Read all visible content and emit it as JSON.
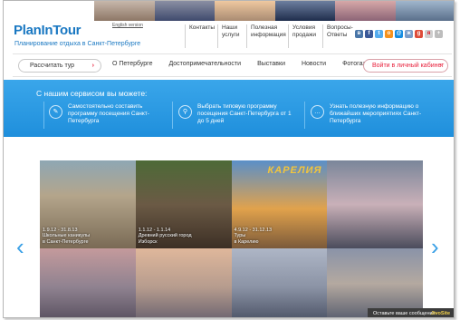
{
  "header": {
    "logo": "PlanInTour",
    "english_link": "English version",
    "tagline": "Планирование отдыха в Санкт-Петербурге",
    "top_nav": [
      "Контакты",
      "Наши услуги",
      "Полезная информация",
      "Условия продажи",
      "Вопросы-Ответы"
    ]
  },
  "socials": [
    {
      "icon": "vk-icon",
      "color": "#4a76a8",
      "glyph": "в"
    },
    {
      "icon": "facebook-icon",
      "color": "#3b5998",
      "glyph": "f"
    },
    {
      "icon": "twitter-icon",
      "color": "#55acee",
      "glyph": "t"
    },
    {
      "icon": "odnoklassniki-icon",
      "color": "#f7931e",
      "glyph": "о"
    },
    {
      "icon": "mailru-icon",
      "color": "#168de2",
      "glyph": "@"
    },
    {
      "icon": "livejournal-icon",
      "color": "#7a9cc9",
      "glyph": "ж"
    },
    {
      "icon": "google-icon",
      "color": "#dd4b39",
      "glyph": "g"
    },
    {
      "icon": "yandex-icon",
      "color": "#cfcfcf",
      "glyph": "я"
    },
    {
      "icon": "plus-icon",
      "color": "#bdbdbd",
      "glyph": "+"
    }
  ],
  "navbar": {
    "calc_button": "Рассчитать тур",
    "links": [
      "О Петербурге",
      "Достопримечательности",
      "Выставки",
      "Новости",
      "Фотогалерея"
    ],
    "login_button": "Войти в личный кабинет",
    "arrow": "›"
  },
  "service": {
    "title": "С нашим сервисом вы можете:",
    "features": [
      {
        "text": "Самостоятельно составить программу посещения Санкт-Петербурга",
        "glyph": "✎"
      },
      {
        "text": "Выбрать типовую программу посещения Санкт-Петербурга от 1 до 5 дней",
        "glyph": "⚲"
      },
      {
        "text": "Узнать полезную информацию о ближайших мероприятиях Санкт-Петербурга",
        "glyph": "…"
      }
    ]
  },
  "gallery": {
    "tiles": [
      {
        "dates": "1.9.12 - 31.8.13",
        "title": "Школьные каникулы",
        "place": "в Санкт-Петербурге"
      },
      {
        "dates": "1.1.12 - 1.1.14",
        "title": "Древний русский город",
        "place": "Изборск"
      },
      {
        "dates": "4.9.12 - 31.12.13",
        "title": "Туры",
        "place": "в Карелию",
        "overlay": "КАРЕЛИЯ"
      },
      {
        "dates": "",
        "title": "",
        "place": ""
      },
      {
        "dates": "",
        "title": "",
        "place": ""
      },
      {
        "dates": "",
        "title": "",
        "place": ""
      },
      {
        "dates": "",
        "title": "",
        "place": ""
      },
      {
        "dates": "",
        "title": "",
        "place": ""
      }
    ],
    "prev": "‹",
    "next": "›"
  },
  "chat": {
    "label": "Оставьте ваше сообщение",
    "brand": "JivoSite"
  }
}
